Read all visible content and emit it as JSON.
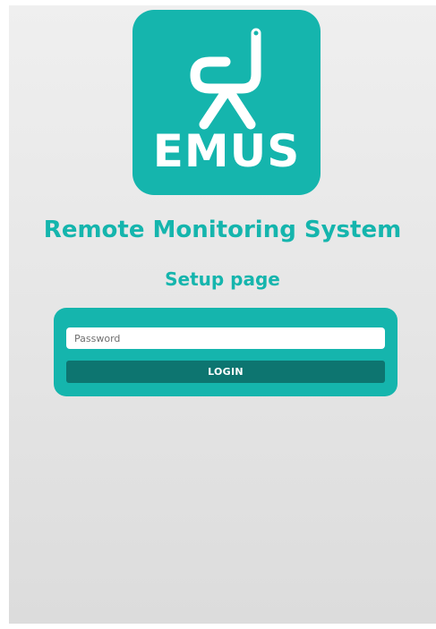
{
  "logo": {
    "text": "EMUS",
    "background_color": "#15b5ad",
    "icon": "emus-figure-icon"
  },
  "header": {
    "title": "Remote Monitoring System",
    "subtitle": "Setup page"
  },
  "login": {
    "password_placeholder": "Password",
    "password_value": "",
    "button_label": "LOGIN",
    "box_color": "#15b5ad",
    "button_color": "#0d7570"
  }
}
